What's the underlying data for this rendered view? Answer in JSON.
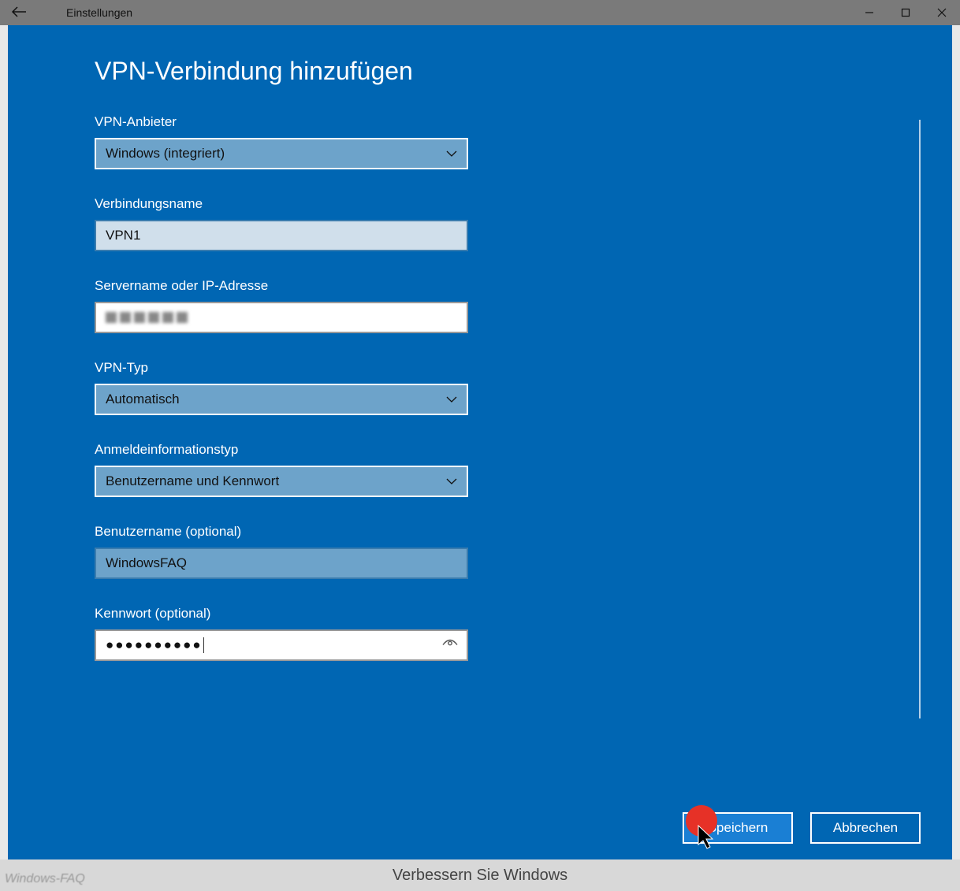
{
  "titlebar": {
    "app_title": "Einstellungen"
  },
  "dialog": {
    "heading": "VPN-Verbindung hinzufügen",
    "fields": {
      "provider": {
        "label": "VPN-Anbieter",
        "value": "Windows (integriert)"
      },
      "connection_name": {
        "label": "Verbindungsname",
        "value": "VPN1"
      },
      "server": {
        "label": "Servername oder IP-Adresse",
        "value": ""
      },
      "vpn_type": {
        "label": "VPN-Typ",
        "value": "Automatisch"
      },
      "auth_type": {
        "label": "Anmeldeinformationstyp",
        "value": "Benutzername und Kennwort"
      },
      "username": {
        "label": "Benutzername (optional)",
        "value": "WindowsFAQ"
      },
      "password": {
        "label": "Kennwort (optional)",
        "value": "●●●●●●●●●●"
      }
    },
    "buttons": {
      "save": "Speichern",
      "cancel": "Abbrechen"
    }
  },
  "footer_text": "Verbessern Sie Windows",
  "watermark": "Windows-FAQ"
}
